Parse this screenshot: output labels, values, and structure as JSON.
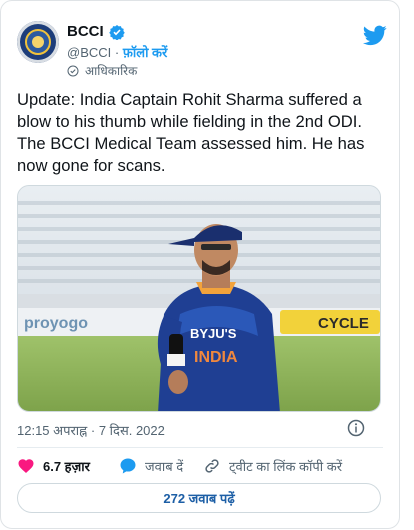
{
  "account": {
    "name": "BCCI",
    "handle": "@BCCI",
    "separator": "·",
    "follow_label": "फ़ॉलो करें",
    "official_label": "आधिकारिक"
  },
  "tweet": {
    "text": "Update: India Captain Rohit Sharma suffered a blow to his thumb while fielding in the 2nd ODI. The BCCI Medical Team assessed him. He has now gone for scans.",
    "time": "12:15 अपराह्न",
    "dot": "·",
    "date": "7 दिस. 2022"
  },
  "image": {
    "jersey_name": "BYJU'S",
    "jersey_country": "INDIA",
    "ad_left": "proyogo",
    "ad_right": "CYCLE"
  },
  "actions": {
    "likes_count": "6.7 हज़ार",
    "reply_label": "जवाब दें",
    "copy_link_label": "ट्वीट का लिंक कॉपी करें"
  },
  "replies_button": "272 जवाब पढ़ें",
  "colors": {
    "accent": "#1d9bf0",
    "like": "#f91880",
    "text": "#0f1419",
    "muted": "#536471"
  },
  "icons": [
    "verified-badge-icon",
    "official-check-icon",
    "twitter-bird-icon",
    "info-icon",
    "heart-icon",
    "reply-bubble-icon",
    "link-icon"
  ]
}
